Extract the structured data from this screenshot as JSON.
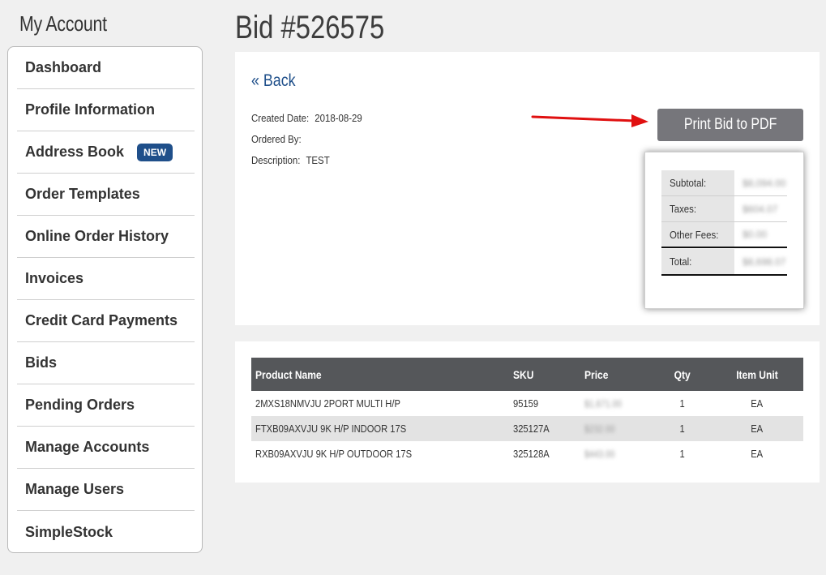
{
  "sidebar": {
    "title": "My Account",
    "items": [
      {
        "label": "Dashboard"
      },
      {
        "label": "Profile Information"
      },
      {
        "label": "Address Book",
        "badge": "NEW"
      },
      {
        "label": "Order Templates"
      },
      {
        "label": "Online Order History"
      },
      {
        "label": "Invoices"
      },
      {
        "label": "Credit Card Payments"
      },
      {
        "label": "Bids"
      },
      {
        "label": "Pending Orders"
      },
      {
        "label": "Manage Accounts"
      },
      {
        "label": "Manage Users"
      },
      {
        "label": "SimpleStock"
      }
    ],
    "badge_color": "#1f4f8a"
  },
  "main": {
    "title": "Bid #526575",
    "back_label": "« Back",
    "created_label": "Created Date:",
    "created_value": "2018-08-29",
    "ordered_label": "Ordered By:",
    "ordered_value": "",
    "description_label": "Description:",
    "description_value": "TEST",
    "print_label": "Print Bid to PDF",
    "totals": [
      {
        "label": "Subtotal:",
        "value": "$8,094.00"
      },
      {
        "label": "Taxes:",
        "value": "$604.07"
      },
      {
        "label": "Other Fees:",
        "value": "$0.00"
      },
      {
        "label": "Total:",
        "value": "$8,698.07"
      }
    ]
  },
  "table": {
    "headers": {
      "product_name": "Product Name",
      "sku": "SKU",
      "price": "Price",
      "qty": "Qty",
      "item_unit": "Item Unit"
    },
    "rows": [
      {
        "product_name": "2MXS18NMVJU 2PORT MULTI H/P",
        "sku": "95159",
        "price": "$1,671.00",
        "qty": "1",
        "item_unit": "EA"
      },
      {
        "product_name": "FTXB09AXVJU 9K H/P INDOOR 17S",
        "sku": "325127A",
        "price": "$232.00",
        "qty": "1",
        "item_unit": "EA"
      },
      {
        "product_name": "RXB09AXVJU 9K H/P OUTDOOR 17S",
        "sku": "325128A",
        "price": "$443.00",
        "qty": "1",
        "item_unit": "EA"
      }
    ]
  },
  "colors": {
    "accent": "#1f4f8a",
    "button": "#76767b",
    "table_header": "#55575a",
    "arrow": "#e01010"
  },
  "icons": [
    "red-arrow-annotation"
  ]
}
